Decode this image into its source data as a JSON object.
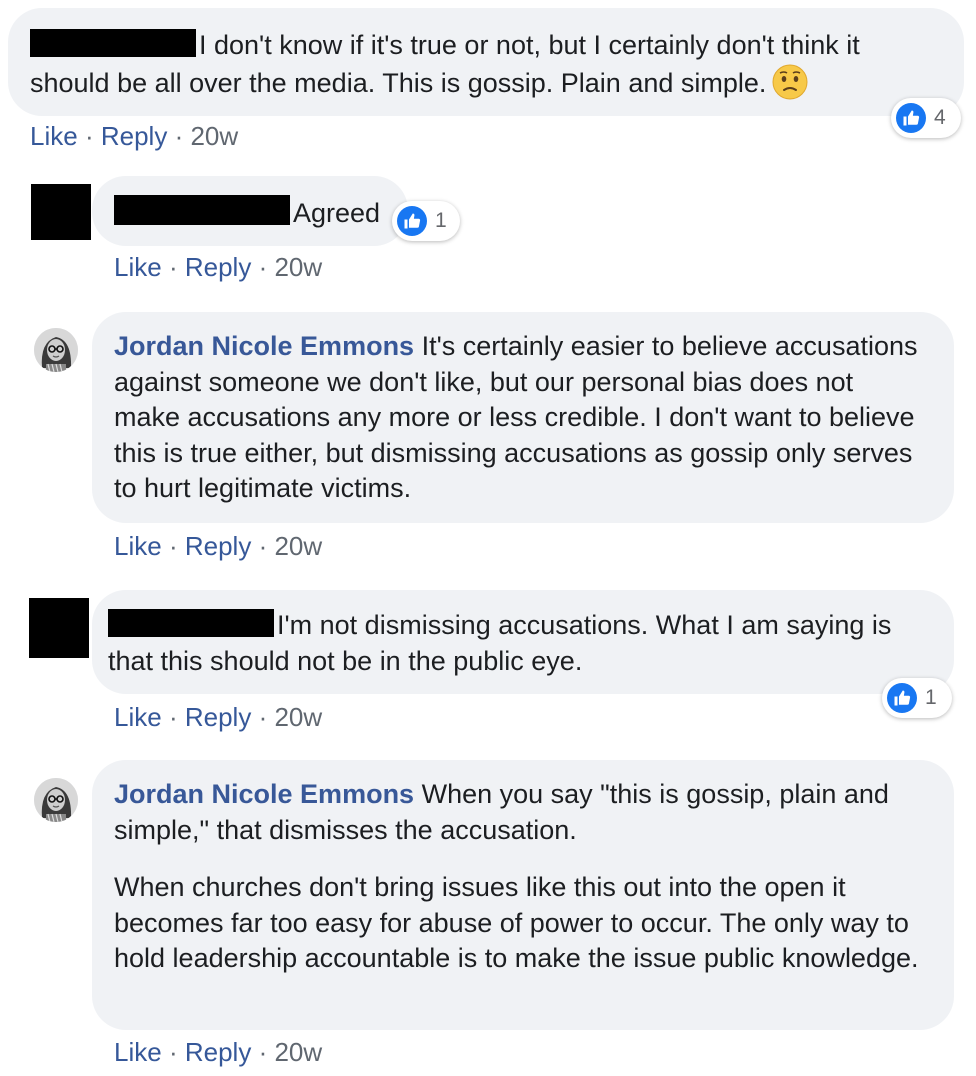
{
  "comments": [
    {
      "author": "",
      "text": "I don't know if it's true or not, but I certainly don't think it should be all over the media. This is gossip. Plain and simple.",
      "emoji": "confused-face-icon",
      "likes": "4",
      "actions": {
        "like": "Like",
        "reply": "Reply",
        "time": "20w",
        "sep": "·"
      }
    },
    {
      "author": "",
      "text": "Agreed",
      "likes": "1",
      "actions": {
        "like": "Like",
        "reply": "Reply",
        "time": "20w",
        "sep": "·"
      }
    },
    {
      "author": "Jordan Nicole Emmons",
      "text": "It's certainly easier to believe accusations against someone we don't like, but our personal bias does not make accusations any more or less credible. I don't want to believe this is true either, but dismissing accusations as gossip only serves to hurt legitimate victims.",
      "actions": {
        "like": "Like",
        "reply": "Reply",
        "time": "20w",
        "sep": "·"
      }
    },
    {
      "author": "",
      "text": "I'm not dismissing accusations. What I am saying is that this should not be in the public eye.",
      "likes": "1",
      "actions": {
        "like": "Like",
        "reply": "Reply",
        "time": "20w",
        "sep": "·"
      }
    },
    {
      "author": "Jordan Nicole Emmons",
      "text": "When you say \"this is gossip, plain and simple,\" that dismisses the accusation.",
      "text2": "When churches don't bring issues like this out into the open it becomes far too easy for abuse of power to occur. The only way to hold leadership accountable is to make the issue public knowledge.",
      "actions": {
        "like": "Like",
        "reply": "Reply",
        "time": "20w",
        "sep": "·"
      }
    }
  ],
  "colors": {
    "bubble": "#f0f2f5",
    "author": "#385898",
    "link": "#365899",
    "like_blue": "#1877f2",
    "redaction": "#000000"
  }
}
